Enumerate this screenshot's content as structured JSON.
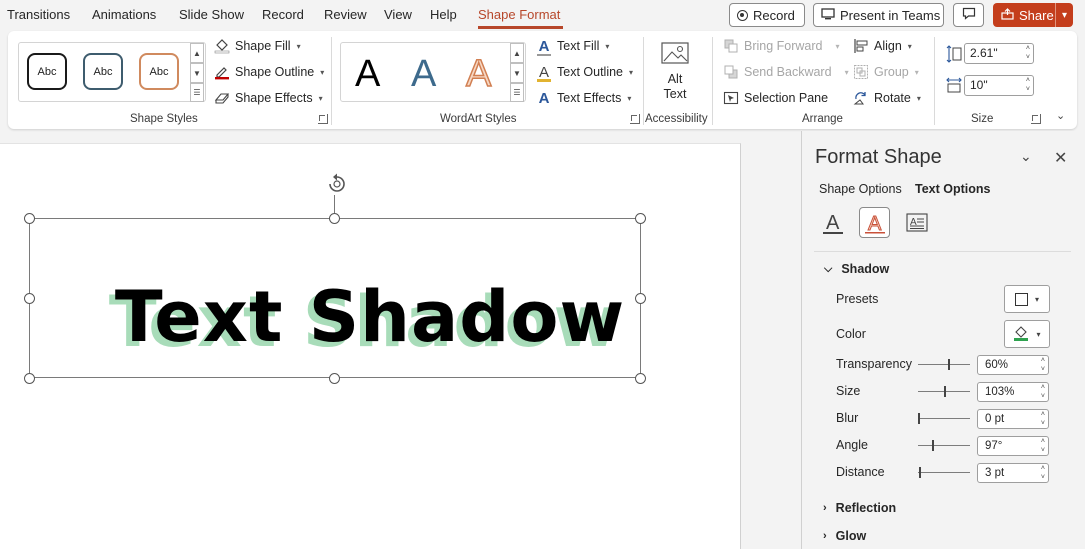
{
  "menu": {
    "tabs": [
      "Transitions",
      "Animations",
      "Slide Show",
      "Record",
      "Review",
      "View",
      "Help",
      "Shape Format"
    ],
    "active_tab": "Shape Format",
    "record_label": "Record",
    "present_teams_label": "Present in Teams",
    "share_label": "Share"
  },
  "ribbon": {
    "shape_styles": {
      "label": "Shape Styles",
      "presets": [
        "Abc",
        "Abc",
        "Abc"
      ],
      "shape_fill": "Shape Fill",
      "shape_outline": "Shape Outline",
      "shape_effects": "Shape Effects"
    },
    "wordart_styles": {
      "label": "WordArt Styles",
      "presets": [
        "A",
        "A",
        "A"
      ],
      "text_fill": "Text Fill",
      "text_outline": "Text Outline",
      "text_effects": "Text Effects"
    },
    "accessibility": {
      "label": "Accessibility",
      "alt_text_line1": "Alt",
      "alt_text_line2": "Text"
    },
    "arrange": {
      "label": "Arrange",
      "bring_forward": "Bring Forward",
      "send_backward": "Send Backward",
      "selection_pane": "Selection Pane",
      "align": "Align",
      "group": "Group",
      "rotate": "Rotate"
    },
    "size": {
      "label": "Size",
      "height": "2.61\"",
      "width": "10\""
    }
  },
  "slide": {
    "text": "Text Shadow"
  },
  "format_pane": {
    "title": "Format Shape",
    "tab_shape": "Shape Options",
    "tab_text": "Text Options",
    "shadow": {
      "header": "Shadow",
      "presets_label": "Presets",
      "color_label": "Color",
      "transparency_label": "Transparency",
      "transparency": "60%",
      "size_label": "Size",
      "size": "103%",
      "blur_label": "Blur",
      "blur": "0 pt",
      "angle_label": "Angle",
      "angle": "97°",
      "distance_label": "Distance",
      "distance": "3 pt"
    },
    "reflection_header": "Reflection",
    "glow_header": "Glow"
  },
  "colors": {
    "accent": "#b7472a",
    "share_bg": "#c43e1c",
    "shadow_color": "#a8dcb9",
    "text_color": "#000000"
  }
}
